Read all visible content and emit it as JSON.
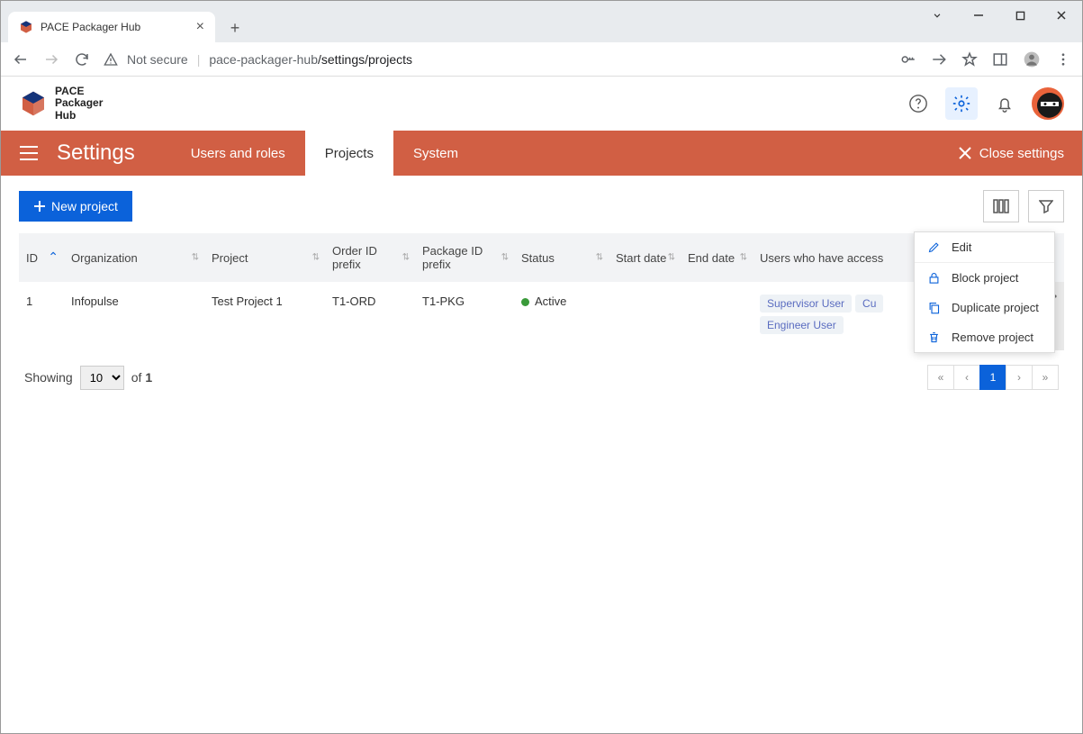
{
  "browser": {
    "tab_title": "PACE Packager Hub",
    "url_host": "pace-packager-hub",
    "url_path": "/settings/projects",
    "not_secure_label": "Not secure"
  },
  "app": {
    "logo_text_line1": "PACE",
    "logo_text_line2": "Packager",
    "logo_text_line3": "Hub"
  },
  "nav": {
    "title": "Settings",
    "tabs": [
      {
        "label": "Users and roles",
        "active": false
      },
      {
        "label": "Projects",
        "active": true
      },
      {
        "label": "System",
        "active": false
      }
    ],
    "close_label": "Close settings"
  },
  "toolbar": {
    "new_project_label": "New project"
  },
  "table": {
    "columns": [
      {
        "label": "ID",
        "sort": "asc"
      },
      {
        "label": "Organization"
      },
      {
        "label": "Project"
      },
      {
        "label": "Order ID prefix"
      },
      {
        "label": "Package ID prefix"
      },
      {
        "label": "Status"
      },
      {
        "label": "Start date"
      },
      {
        "label": "End date"
      },
      {
        "label": "Users who have access"
      }
    ],
    "rows": [
      {
        "id": "1",
        "organization": "Infopulse",
        "project": "Test Project 1",
        "order_prefix": "T1-ORD",
        "package_prefix": "T1-PKG",
        "status": "Active",
        "start_date": "",
        "end_date": "",
        "users": [
          "Supervisor User",
          "Cu",
          "Engineer User"
        ]
      }
    ]
  },
  "context_menu": {
    "items": [
      {
        "icon": "pencil-icon",
        "label": "Edit"
      },
      {
        "icon": "lock-icon",
        "label": "Block project"
      },
      {
        "icon": "copy-icon",
        "label": "Duplicate project"
      },
      {
        "icon": "trash-icon",
        "label": "Remove project"
      }
    ]
  },
  "footer": {
    "showing_label": "Showing",
    "page_size": "10",
    "of_label": "of",
    "total": "1",
    "current_page": "1"
  }
}
